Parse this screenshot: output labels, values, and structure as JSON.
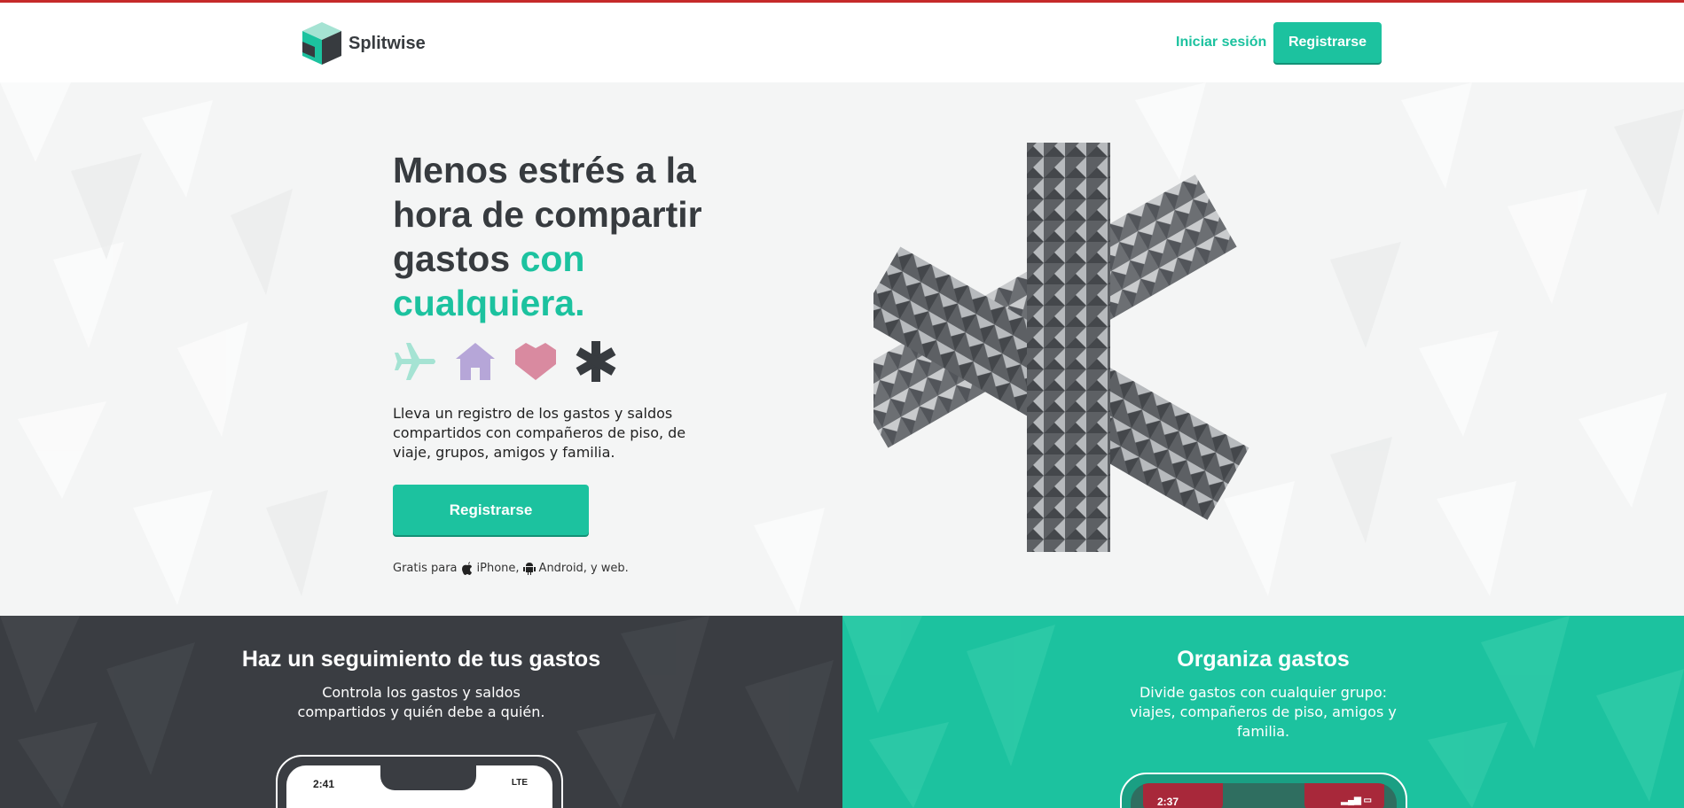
{
  "header": {
    "brand": "Splitwise",
    "login_label": "Iniciar sesión",
    "signup_label": "Registrarse"
  },
  "hero": {
    "title_main": "Menos estrés a la hora de compartir gastos",
    "title_accent": "con cualquiera.",
    "description": "Lleva un registro de los gastos y saldos compartidos con compañeros de piso, de viaje, grupos, amigos y familia.",
    "cta_label": "Registrarse",
    "platforms": {
      "prefix": "Gratis para",
      "iphone": "iPhone,",
      "android": "Android,",
      "web": "y web."
    },
    "icons": [
      "airplane-icon",
      "house-icon",
      "heart-icon",
      "asterisk-icon"
    ]
  },
  "features": {
    "track": {
      "title": "Haz un seguimiento de tus gastos",
      "text": "Controla los gastos y saldos compartidos y quién debe a quién.",
      "phone_time": "2:41",
      "phone_status": "LTE"
    },
    "organize": {
      "title": "Organiza gastos",
      "text": "Divide gastos con cualquier grupo: viajes, compañeros de piso, amigos y familia.",
      "phone_time": "2:37"
    }
  },
  "colors": {
    "brand_green": "#1cc29f",
    "dark": "#373b3f",
    "plane": "#a5e3d3",
    "house": "#b6a6d8",
    "heart": "#d98aa0",
    "top_line": "#c52a2a"
  }
}
